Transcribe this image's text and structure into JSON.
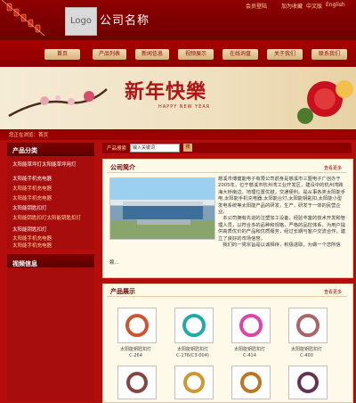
{
  "header": {
    "logo": "Logo",
    "company": "公司名称",
    "links": [
      "会员登陆",
      "加为收藏",
      "中文版",
      "English"
    ]
  },
  "nav": [
    "首页",
    "产品列表",
    "新闻信息",
    "视频展示",
    "在线询盘",
    "关于我们",
    "联系我们"
  ],
  "banner": {
    "title": "新年快樂",
    "subtitle": "HAPPY NEW YEAR"
  },
  "breadcrumb": "您正在浏览：首页",
  "sidebar": {
    "categories_title": "产品分类",
    "items": [
      {
        "label": "太阳能草坪灯太阳能草坪用灯",
        "sub": false
      },
      {
        "label": "太阳能手机充电器",
        "sub": false
      },
      {
        "label": "太阳能手机充电器",
        "sub": true
      },
      {
        "label": "太阳能手机充电器",
        "sub": true
      },
      {
        "label": "太阳能钥匙扣灯",
        "sub": false
      },
      {
        "label": "太阳能钥匙扣灯太阳能钥匙扣灯",
        "sub": true
      },
      {
        "label": "太阳能钥匙扣灯",
        "sub": false
      },
      {
        "label": "太阳能手机充电器",
        "sub": true
      },
      {
        "label": "太阳能手机充电器",
        "sub": true
      }
    ],
    "video_title": "视频信息"
  },
  "search": {
    "label": "产品搜索",
    "placeholder": "输入关键词",
    "button": "搜"
  },
  "about": {
    "title": "公司简介",
    "more": "查看更多",
    "text": "慈溪市博健能电子有限公司前身是慈溪市三盟电子厂创办于2005年，位于慈溪市杭州湾工业开发区，建设中的杭州湾跨海大桥南边，地理位置优越，交通便利。是从事各类太阳能手电,太阳能手机充电器,太阳能台灯,太阳能钥匙扣,太阳能小型发电系统等太阳能产品的研发，生产，研发于一体的民营企业。\n　本公司拥有先进的注塑加工设备，经验丰富的技术开发和管理人员，以符合多的品种和规格，严格的品控体系，为用户提供高质优价的产品和优质服务，经过长期与客户交流合作，建立了良好的市场信誉。\n　我们的一贯宗旨是以诚相待，积极进取，为做一个您所信",
    "tail": "赖..."
  },
  "products": {
    "title": "产品展示",
    "more": "查看更多",
    "items": [
      {
        "name": "太阳能钥匙扣灯",
        "code": "C-264"
      },
      {
        "name": "太阳能钥匙扣灯",
        "code": "C-176(C3-004)"
      },
      {
        "name": "太阳能钥匙扣灯",
        "code": "C-414"
      },
      {
        "name": "太阳能钥匙扣灯",
        "code": "C-400"
      }
    ]
  },
  "colors": {
    "primary_red": "#b40d0d",
    "dark_red": "#6f0000",
    "gold": "#d7b27a",
    "cream": "#fff9ea"
  }
}
